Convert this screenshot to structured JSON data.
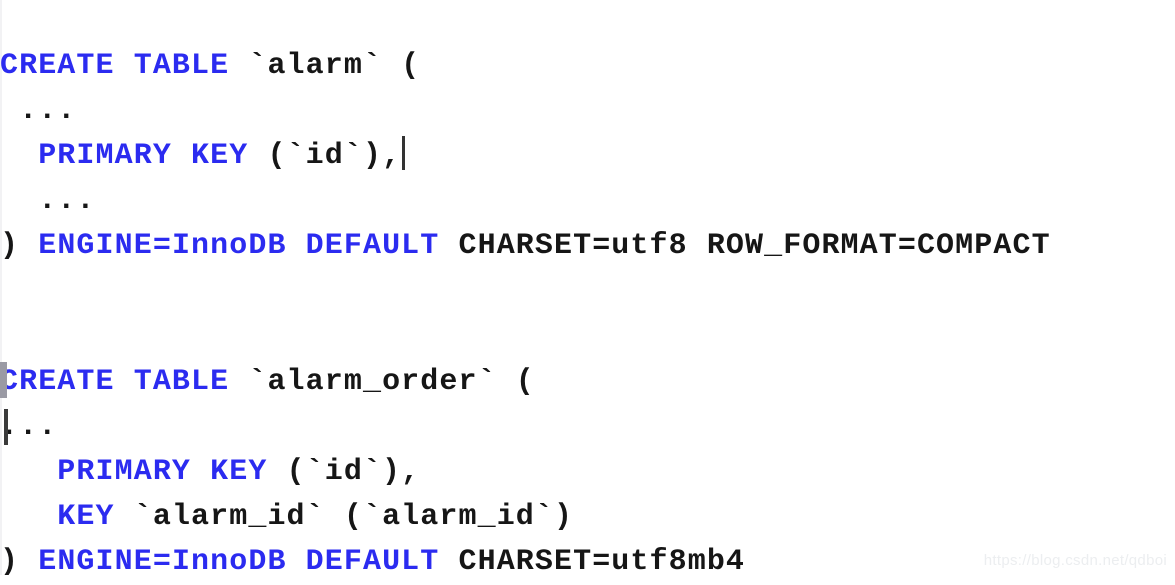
{
  "document": {
    "kind": "sql-code-screenshot",
    "background_color": "#ffffff",
    "keyword_color": "#2b2bf0",
    "identifier_color": "#161616",
    "caret_color": "#333333"
  },
  "blocks": [
    {
      "id": "alarm",
      "lines": [
        {
          "id": "alarm-create",
          "segments": [
            {
              "text": "CREATE TABLE ",
              "kind": "keyword"
            },
            {
              "text": "`alarm` (",
              "kind": "identifier"
            }
          ]
        },
        {
          "id": "alarm-ellipsis-top",
          "segments": [
            {
              "text": " ...",
              "kind": "dots"
            }
          ]
        },
        {
          "id": "alarm-primary-key",
          "segments": [
            {
              "text": "  PRIMARY KEY ",
              "kind": "keyword"
            },
            {
              "text": "(`id`),",
              "kind": "identifier"
            }
          ],
          "caret_after": true
        },
        {
          "id": "alarm-ellipsis-bottom",
          "segments": [
            {
              "text": "  ...",
              "kind": "dots"
            }
          ]
        },
        {
          "id": "alarm-engine",
          "segments": [
            {
              "text": ") ",
              "kind": "identifier"
            },
            {
              "text": "ENGINE=InnoDB DEFAULT ",
              "kind": "keyword"
            },
            {
              "text": "CHARSET=utf8 ROW_FORMAT=COMPACT",
              "kind": "identifier"
            }
          ]
        }
      ]
    },
    {
      "id": "alarm-order",
      "lines": [
        {
          "id": "alarm-order-create",
          "segments": [
            {
              "text": "CREATE TABLE ",
              "kind": "keyword"
            },
            {
              "text": "`alarm_order` (",
              "kind": "identifier"
            }
          ],
          "selection_mark_left": true
        },
        {
          "id": "alarm-order-ellipsis",
          "segments": [
            {
              "text": "...",
              "kind": "dots"
            }
          ],
          "caret_left": true
        },
        {
          "id": "alarm-order-primary-key",
          "segments": [
            {
              "text": "   PRIMARY KEY ",
              "kind": "keyword"
            },
            {
              "text": "(`id`),",
              "kind": "identifier"
            }
          ]
        },
        {
          "id": "alarm-order-key",
          "segments": [
            {
              "text": "   KEY ",
              "kind": "keyword"
            },
            {
              "text": "`alarm_id` (`alarm_id`)",
              "kind": "identifier"
            }
          ]
        },
        {
          "id": "alarm-order-engine",
          "segments": [
            {
              "text": ") ",
              "kind": "identifier"
            },
            {
              "text": "ENGINE=InnoDB DEFAULT ",
              "kind": "keyword"
            },
            {
              "text": "CHARSET=utf8mb4",
              "kind": "identifier"
            }
          ]
        }
      ]
    }
  ],
  "watermark": {
    "text": "https://blog.csdn.net/qdboi"
  }
}
